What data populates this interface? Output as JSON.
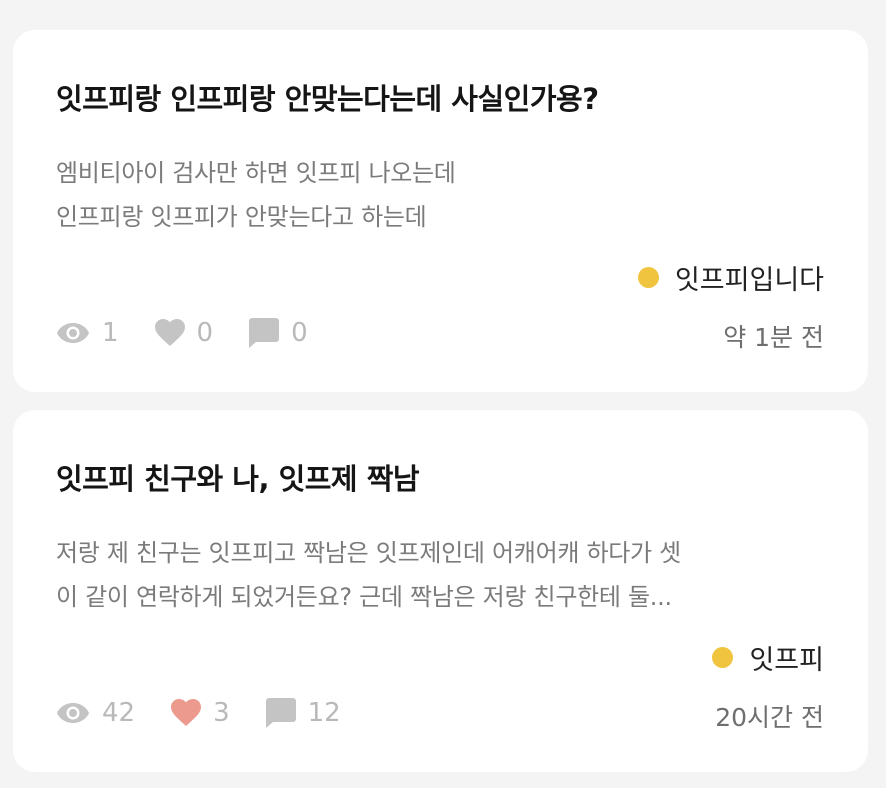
{
  "posts": [
    {
      "title": "잇프피랑 인프피랑 안맞는다는데 사실인가용?",
      "excerpt_lines": [
        "엠비티아이 검사만 하면 잇프피 나오는데",
        "인프피랑 잇프피가 안맞는다고 하는데"
      ],
      "author": "잇프피입니다",
      "author_dot_color": "#f0c43e",
      "views": "1",
      "likes": "0",
      "comments": "0",
      "liked": false,
      "time": "약 1분 전"
    },
    {
      "title": "잇프피 친구와 나, 잇프제 짝남",
      "excerpt_lines": [
        "저랑 제 친구는 잇프피고 짝남은 잇프제인데 어캐어캐 하다가 셋",
        "이 같이 연락하게 되었거든요? 근데 짝남은 저랑 친구한테 둘..."
      ],
      "author": "잇프피",
      "author_dot_color": "#f0c43e",
      "views": "42",
      "likes": "3",
      "comments": "12",
      "liked": true,
      "time": "20시간 전"
    }
  ],
  "colors": {
    "icon_gray": "#c4c4c4",
    "like_active": "#ec9a8e",
    "author_dot": "#f0c43e"
  }
}
